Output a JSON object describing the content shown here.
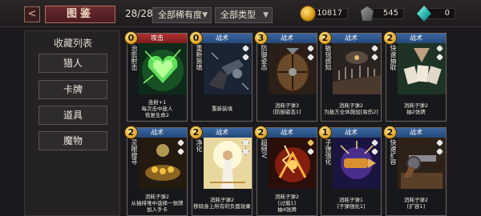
{
  "topbar": {
    "back_glyph": "<",
    "title": "图鉴",
    "count": "28/28",
    "rarity_filter": "全部稀有度",
    "type_filter": "全部类型",
    "currencies": [
      {
        "icon": "gold-coin-icon",
        "value": "10817"
      },
      {
        "icon": "ore-icon",
        "value": "545"
      },
      {
        "icon": "gem-icon",
        "value": "0"
      }
    ]
  },
  "sidebar": {
    "title": "收藏列表",
    "items": [
      {
        "label": "猎人"
      },
      {
        "label": "卡牌"
      },
      {
        "label": "道具"
      },
      {
        "label": "魔物"
      }
    ]
  },
  "cards": [
    {
      "cost": "0",
      "type": "攻击",
      "name": "治愈射击",
      "desc": [
        "连射+1",
        "每次击中敌人",
        "恢复生命2"
      ],
      "art": "green-heal"
    },
    {
      "cost": "0",
      "type": "战术",
      "name": "重新装填",
      "desc": [
        "重新装填"
      ],
      "art": "reload"
    },
    {
      "cost": "3",
      "type": "战术",
      "name": "防御姿态",
      "desc": [
        "消耗子弹3",
        "[防御姿态1]"
      ],
      "art": "shield"
    },
    {
      "cost": "2",
      "type": "战术",
      "name": "敏锐感知",
      "desc": [
        "消耗子弹2",
        "为敌方全体施加[易伤2]"
      ],
      "art": "sense"
    },
    {
      "cost": "2",
      "type": "战术",
      "name": "快速抽取",
      "desc": [
        "消耗子弹2",
        "抽2张牌"
      ],
      "art": "draw"
    },
    {
      "cost": "2",
      "type": "战术",
      "name": "灵眼搜寻",
      "desc": [
        "消耗子弹2",
        "从抽排堆中选择一张牌",
        "加入手卡"
      ],
      "art": "search"
    },
    {
      "cost": "2",
      "type": "战术",
      "name": "净化",
      "desc": [
        "消耗子弹2",
        "移除身上所有的负面效果"
      ],
      "art": "purify"
    },
    {
      "cost": "2",
      "type": "战术",
      "name": "超频IV",
      "desc": [
        "消耗子弹2",
        "[过载1]",
        "抽4张牌"
      ],
      "art": "overclock"
    },
    {
      "cost": "1",
      "type": "战术",
      "name": "子弹强化",
      "desc": [
        "消耗子弹1",
        "[子弹强化1]"
      ],
      "art": "bullet"
    },
    {
      "cost": "2",
      "type": "战术",
      "name": "快速扩容",
      "desc": [
        "消耗子弹2",
        "[扩容1]"
      ],
      "art": "revolver"
    }
  ]
}
